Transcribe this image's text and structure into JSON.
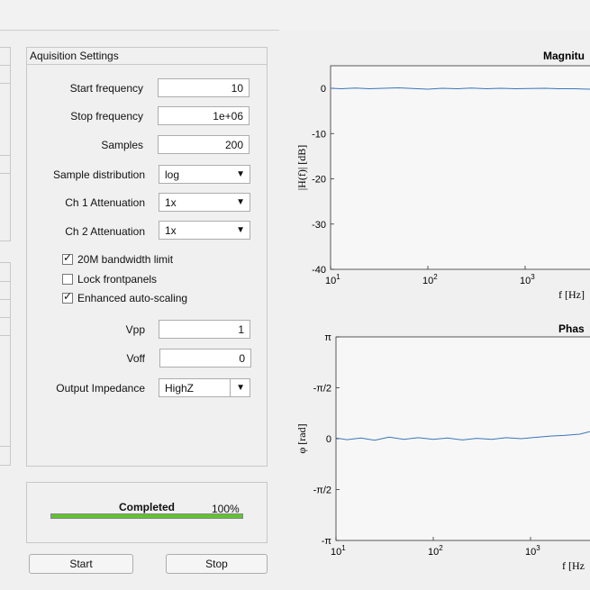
{
  "acq": {
    "title": "Aquisition Settings",
    "start_label": "Start frequency",
    "start_value": "10",
    "stop_label": "Stop frequency",
    "stop_value": "1e+06",
    "samples_label": "Samples",
    "samples_value": "200",
    "dist_label": "Sample distribution",
    "dist_value": "log",
    "ch1_label": "Ch 1 Attenuation",
    "ch1_value": "1x",
    "ch2_label": "Ch 2 Attenuation",
    "ch2_value": "1x",
    "bw_label": "20M bandwidth limit",
    "bw_checked": true,
    "lock_label": "Lock frontpanels",
    "lock_checked": false,
    "scale_label": "Enhanced auto-scaling",
    "scale_checked": true,
    "vpp_label": "Vpp",
    "vpp_value": "1",
    "voff_label": "Voff",
    "voff_value": "0",
    "imp_label": "Output Impedance",
    "imp_value": "HighZ"
  },
  "progress": {
    "label": "Completed",
    "percent_text": "100%",
    "fraction": 1.0,
    "color": "#60c430"
  },
  "buttons": {
    "start": "Start",
    "stop": "Stop"
  },
  "icons": {
    "dropdown": "▼",
    "checkmark": "✓"
  },
  "chart_data": [
    {
      "type": "line",
      "title": "Magnitu",
      "xlabel": "f [Hz]",
      "ylabel": "|H(f)| [dB]",
      "xscale": "log",
      "xticks": [
        "10^1",
        "10^2",
        "10^3"
      ],
      "ylim": [
        -40,
        0
      ],
      "yticks": [
        "0",
        "-10",
        "-20",
        "-30",
        "-40"
      ],
      "series": [
        {
          "color": "#3a76b8",
          "x": [
            10,
            13,
            18,
            25,
            35,
            50,
            70,
            100,
            140,
            200,
            280,
            400,
            560,
            800,
            1100,
            1600,
            2200,
            3200,
            4500,
            6500
          ],
          "y": [
            0.0,
            -0.1,
            0.05,
            -0.1,
            0.0,
            0.1,
            -0.05,
            -0.2,
            0.0,
            -0.1,
            0.05,
            -0.1,
            0.0,
            -0.1,
            -0.05,
            0.0,
            -0.1,
            -0.1,
            -0.2,
            -0.3
          ]
        }
      ]
    },
    {
      "type": "line",
      "title": "Phas",
      "xlabel": "f [Hz",
      "ylabel": "φ [rad]",
      "xscale": "log",
      "xticks": [
        "10^1",
        "10^2",
        "10^3"
      ],
      "ylim": [
        -3.14159,
        3.14159
      ],
      "yticks": [
        "π",
        "-π/2",
        "0",
        "-π/2",
        "-π"
      ],
      "series": [
        {
          "color": "#3a76b8",
          "x": [
            10,
            13,
            18,
            25,
            35,
            50,
            70,
            100,
            140,
            200,
            280,
            400,
            560,
            800,
            1100,
            1600,
            2200,
            3200,
            4500,
            6000,
            7500
          ],
          "y": [
            0.02,
            -0.03,
            0.02,
            -0.05,
            0.05,
            -0.02,
            0.03,
            -0.02,
            0.02,
            -0.04,
            0.01,
            -0.02,
            0.03,
            0.0,
            0.04,
            0.08,
            0.1,
            0.14,
            0.25,
            0.35,
            0.45
          ]
        }
      ]
    }
  ]
}
